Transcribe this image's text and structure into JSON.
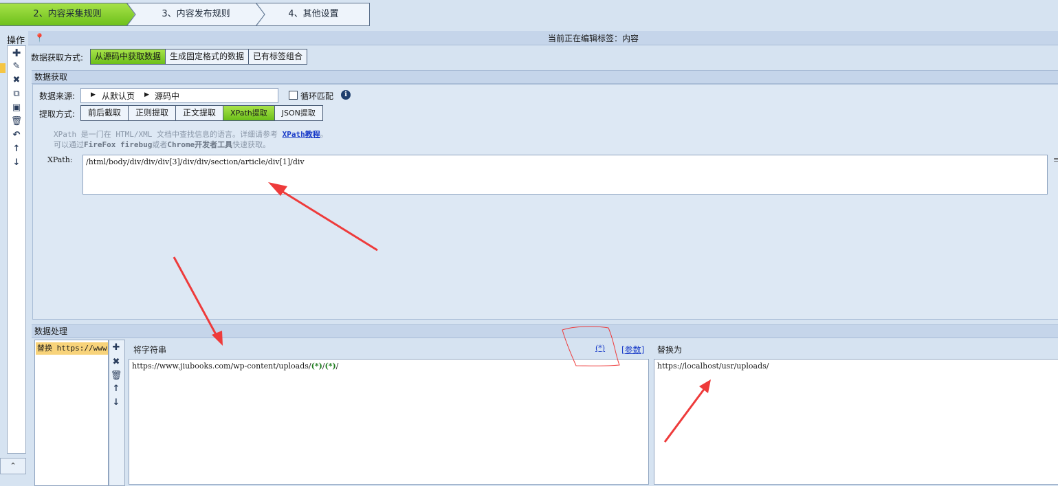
{
  "steps": [
    "2、内容采集规则",
    "3、内容发布规则",
    "4、其他设置"
  ],
  "left_toolbar": {
    "title": "操作"
  },
  "status": {
    "editing_label": "当前正在编辑标签：内容"
  },
  "fetch_mode": {
    "label": "数据获取方式:",
    "options": [
      "从源码中获取数据",
      "生成固定格式的数据",
      "已有标签组合"
    ],
    "active": "从源码中获取数据"
  },
  "data_fetch": {
    "section_title": "数据获取",
    "source_label": "数据来源:",
    "source_items": [
      "从默认页",
      "源码中"
    ],
    "loop_match_label": "循环匹配",
    "loop_match_checked": false,
    "extract_label": "提取方式:",
    "extract_options": [
      "前后截取",
      "正则提取",
      "正文提取",
      "XPath提取",
      "JSON提取"
    ],
    "extract_active": "XPath提取",
    "help_line1_pre": "XPath 是一门在 HTML/XML 文档中查找信息的语言。详细请参考 ",
    "help_link": "XPath教程",
    "help_line1_post": "。",
    "help_line2_pre": "可以通过",
    "help_line2_bold1": "FireFox firebug",
    "help_line2_mid": "或者",
    "help_line2_bold2": "Chrome开发者工具",
    "help_line2_post": "快速获取。",
    "xpath_label": "XPath:",
    "xpath_value": "/html/body/div/div/div[3]/div/div/section/article/div[1]/div"
  },
  "data_processing": {
    "section_title": "数据处理",
    "rules": [
      "替换 https://www"
    ],
    "find_label": "将字符串",
    "wildcard_link": "(*)",
    "param_link": "[参数]",
    "replace_label": "替换为",
    "find_value_prefix": "https://www.jiubooks.com/wp-content/uploads/",
    "find_wildcard": "(*)",
    "find_sep": "/",
    "find_suffix": "/",
    "replace_value": "https://localhost/usr/uploads/"
  },
  "colors": {
    "accent_green": "#8fd13a",
    "annotation_red": "#ee3b3b",
    "link_blue": "#1a3cc8"
  }
}
